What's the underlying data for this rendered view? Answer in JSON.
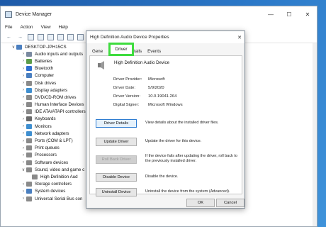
{
  "window": {
    "title": "Device Manager",
    "menu": [
      "File",
      "Action",
      "View",
      "Help"
    ],
    "controls": {
      "minimize": "—",
      "maximize": "☐",
      "close": "✕"
    }
  },
  "tree": {
    "root": "DESKTOP-JPH15CS",
    "items": [
      {
        "label": "Audio inputs and outputs",
        "expanded": false,
        "color": "#7a8aa0"
      },
      {
        "label": "Batteries",
        "expanded": false,
        "color": "#5c9c4a"
      },
      {
        "label": "Bluetooth",
        "expanded": false,
        "color": "#2f6fd0"
      },
      {
        "label": "Computer",
        "expanded": false,
        "color": "#4a7fc0"
      },
      {
        "label": "Disk drives",
        "expanded": false,
        "color": "#8a8a8a"
      },
      {
        "label": "Display adapters",
        "expanded": false,
        "color": "#3f8fd0"
      },
      {
        "label": "DVD/CD-ROM drives",
        "expanded": false,
        "color": "#8a8a8a"
      },
      {
        "label": "Human Interface Devices",
        "expanded": false,
        "color": "#8a8a8a"
      },
      {
        "label": "IDE ATA/ATAPI controllers",
        "expanded": false,
        "color": "#8a8a8a"
      },
      {
        "label": "Keyboards",
        "expanded": false,
        "color": "#6a6a6a"
      },
      {
        "label": "Monitors",
        "expanded": false,
        "color": "#3f8fd0"
      },
      {
        "label": "Network adapters",
        "expanded": false,
        "color": "#3f8fd0"
      },
      {
        "label": "Ports (COM & LPT)",
        "expanded": false,
        "color": "#8a8a8a"
      },
      {
        "label": "Print queues",
        "expanded": false,
        "color": "#8a8a8a"
      },
      {
        "label": "Processors",
        "expanded": false,
        "color": "#8a8a8a"
      },
      {
        "label": "Software devices",
        "expanded": false,
        "color": "#8a8a8a"
      },
      {
        "label": "Sound, video and game c",
        "expanded": true,
        "color": "#8a8a8a"
      },
      {
        "label": "High Definition Aud",
        "child": true,
        "color": "#8a8a8a"
      },
      {
        "label": "Storage controllers",
        "expanded": false,
        "color": "#8a8a8a"
      },
      {
        "label": "System devices",
        "expanded": false,
        "color": "#4a7fc0"
      },
      {
        "label": "Universal Serial Bus con",
        "expanded": false,
        "color": "#8a8a8a"
      }
    ]
  },
  "dialog": {
    "title": "High Definition Audio Device Properties",
    "tabs": [
      "Gene",
      "Driver",
      "tails",
      "Events"
    ],
    "active_tab": "Driver",
    "device_name": "High Definition Audio Device",
    "properties": [
      {
        "key": "Driver Provider:",
        "value": "Microsoft"
      },
      {
        "key": "Driver Date:",
        "value": "5/9/2020"
      },
      {
        "key": "Driver Version:",
        "value": "10.0.19041.264"
      },
      {
        "key": "Digital Signer:",
        "value": "Microsoft Windows"
      }
    ],
    "actions": [
      {
        "label": "Driver Details",
        "desc": "View details about the installed driver files.",
        "state": "primary"
      },
      {
        "label": "Update Driver",
        "desc": "Update the driver for this device.",
        "state": "normal"
      },
      {
        "label": "Roll Back Driver",
        "desc": "If the device fails after updating the driver, roll back to the previously installed driver.",
        "state": "disabled"
      },
      {
        "label": "Disable Device",
        "desc": "Disable the device.",
        "state": "normal"
      },
      {
        "label": "Uninstall Device",
        "desc": "Uninstall the device from the system (Advanced).",
        "state": "normal"
      }
    ],
    "ok_label": "OK",
    "cancel_label": "Cancel"
  },
  "colors": {
    "highlight": "#3fdc3f",
    "desktop": "#2b78c8"
  }
}
